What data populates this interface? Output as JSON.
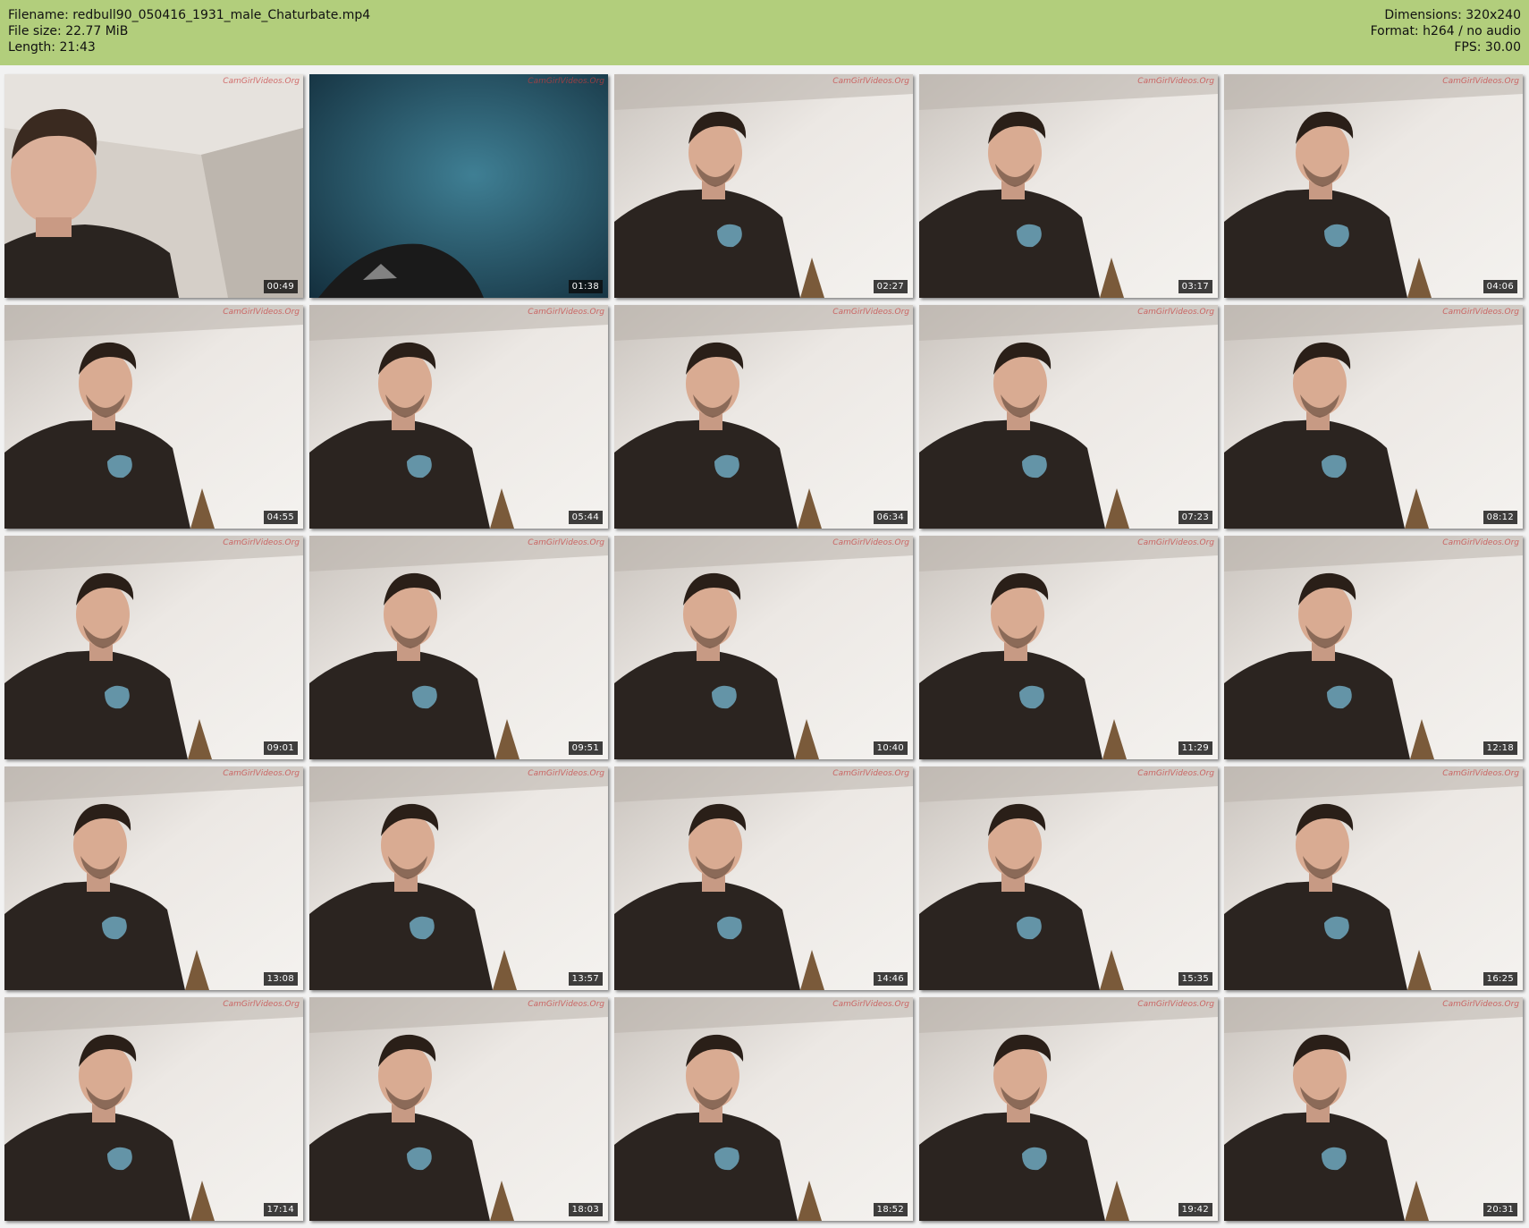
{
  "header": {
    "filename_line": "Filename: redbull90_050416_1931_male_Chaturbate.mp4",
    "filesize_line": "File size: 22.77 MiB",
    "length_line": "Length: 21:43",
    "dimensions_line": "Dimensions: 320x240",
    "format_line": "Format: h264 / no audio",
    "fps_line": "FPS: 30.00",
    "background_color": "#b2ce7c"
  },
  "watermark": "CamGirlVideos.Org",
  "thumbnails": [
    {
      "time": "00:49",
      "scene": "closeup"
    },
    {
      "time": "01:38",
      "scene": "dark"
    },
    {
      "time": "02:27",
      "scene": "seated"
    },
    {
      "time": "03:17",
      "scene": "seated"
    },
    {
      "time": "04:06",
      "scene": "seated"
    },
    {
      "time": "04:55",
      "scene": "seated"
    },
    {
      "time": "05:44",
      "scene": "seated"
    },
    {
      "time": "06:34",
      "scene": "seated"
    },
    {
      "time": "07:23",
      "scene": "seated"
    },
    {
      "time": "08:12",
      "scene": "seated"
    },
    {
      "time": "09:01",
      "scene": "seated"
    },
    {
      "time": "09:51",
      "scene": "seated"
    },
    {
      "time": "10:40",
      "scene": "seated"
    },
    {
      "time": "11:29",
      "scene": "seated"
    },
    {
      "time": "12:18",
      "scene": "seated"
    },
    {
      "time": "13:08",
      "scene": "seated"
    },
    {
      "time": "13:57",
      "scene": "seated"
    },
    {
      "time": "14:46",
      "scene": "seated"
    },
    {
      "time": "15:35",
      "scene": "seated"
    },
    {
      "time": "16:25",
      "scene": "seated"
    },
    {
      "time": "17:14",
      "scene": "seated"
    },
    {
      "time": "18:03",
      "scene": "seated"
    },
    {
      "time": "18:52",
      "scene": "seated"
    },
    {
      "time": "19:42",
      "scene": "seated"
    },
    {
      "time": "20:31",
      "scene": "seated"
    }
  ]
}
